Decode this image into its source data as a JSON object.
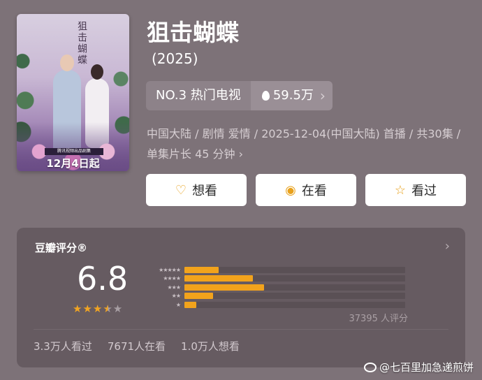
{
  "poster": {
    "title_art": "狙击蝴蝶",
    "tagline": "腾讯视频出品剧集",
    "date_text": "12月4日起"
  },
  "title": "狙击蝴蝶",
  "year": "(2025)",
  "rank": {
    "label": "NO.3 热门电视",
    "heat": "59.5万",
    "chevron": "›"
  },
  "meta": "中国大陆 / 剧情 爱情 / 2025-12-04(中国大陆) 首播 / 共30集 / 单集片长 45 分钟 ›",
  "actions": [
    {
      "label": "想看",
      "icon": "heart-plus-icon",
      "glyph": "♡"
    },
    {
      "label": "在看",
      "icon": "eye-dot-icon",
      "glyph": "◉"
    },
    {
      "label": "看过",
      "icon": "star-outline-icon",
      "glyph": "☆"
    }
  ],
  "rating": {
    "header": "豆瓣评分®",
    "chevron": "›",
    "score": "6.8",
    "stars_filled": 3.5,
    "star_glyph_on": "★★★",
    "star_glyph_half": "★",
    "star_glyph_off": "★",
    "distribution": [
      {
        "stars": "★★★★★",
        "fraction": 0.155
      },
      {
        "stars": "★★★★",
        "fraction": 0.31
      },
      {
        "stars": "★★★",
        "fraction": 0.36
      },
      {
        "stars": "★★",
        "fraction": 0.13
      },
      {
        "stars": "★",
        "fraction": 0.055
      }
    ],
    "count": "37395 人评分",
    "stats": [
      "3.3万人看过",
      "7671人在看",
      "1.0万人想看"
    ]
  },
  "watermark": "@七百里加急递煎饼",
  "colors": {
    "accent": "#f2a31c",
    "background": "#7d7278",
    "panel": "#665b61"
  }
}
